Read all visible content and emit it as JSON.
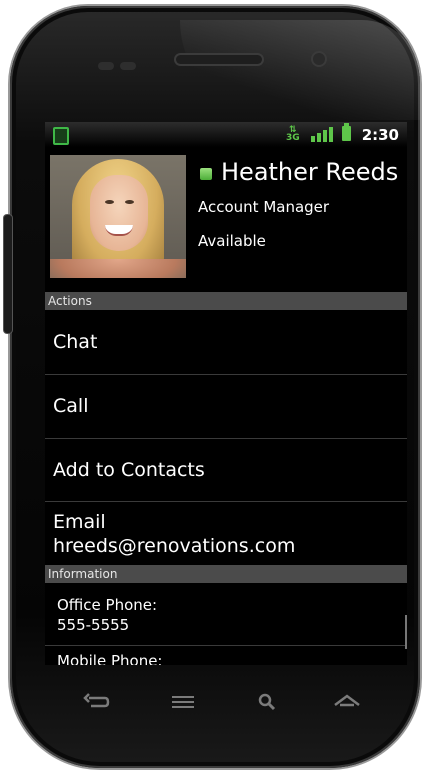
{
  "status_bar": {
    "time": "2:30",
    "network": "3G"
  },
  "contact": {
    "name": "Heather Reeds",
    "title": "Account Manager",
    "presence": "Available"
  },
  "sections": {
    "actions_header": "Actions",
    "information_header": "Information"
  },
  "actions": {
    "chat": "Chat",
    "call": "Call",
    "add_to_contacts": "Add to Contacts",
    "email_label": "Email",
    "email_value": "hreeds@renovations.com"
  },
  "information": {
    "office_label": "Office Phone:",
    "office_value": "555-5555",
    "mobile_label": "Mobile Phone:"
  },
  "icons": {
    "status_left": "app-notification-icon",
    "network": "3g-icon",
    "signal": "signal-icon",
    "battery": "battery-icon",
    "back": "back-icon",
    "menu": "menu-icon",
    "search": "search-icon",
    "home": "home-icon"
  },
  "colors": {
    "presence": "#4cae38",
    "section_header": "#4b4b4b",
    "accent_green": "#5ec64a"
  }
}
